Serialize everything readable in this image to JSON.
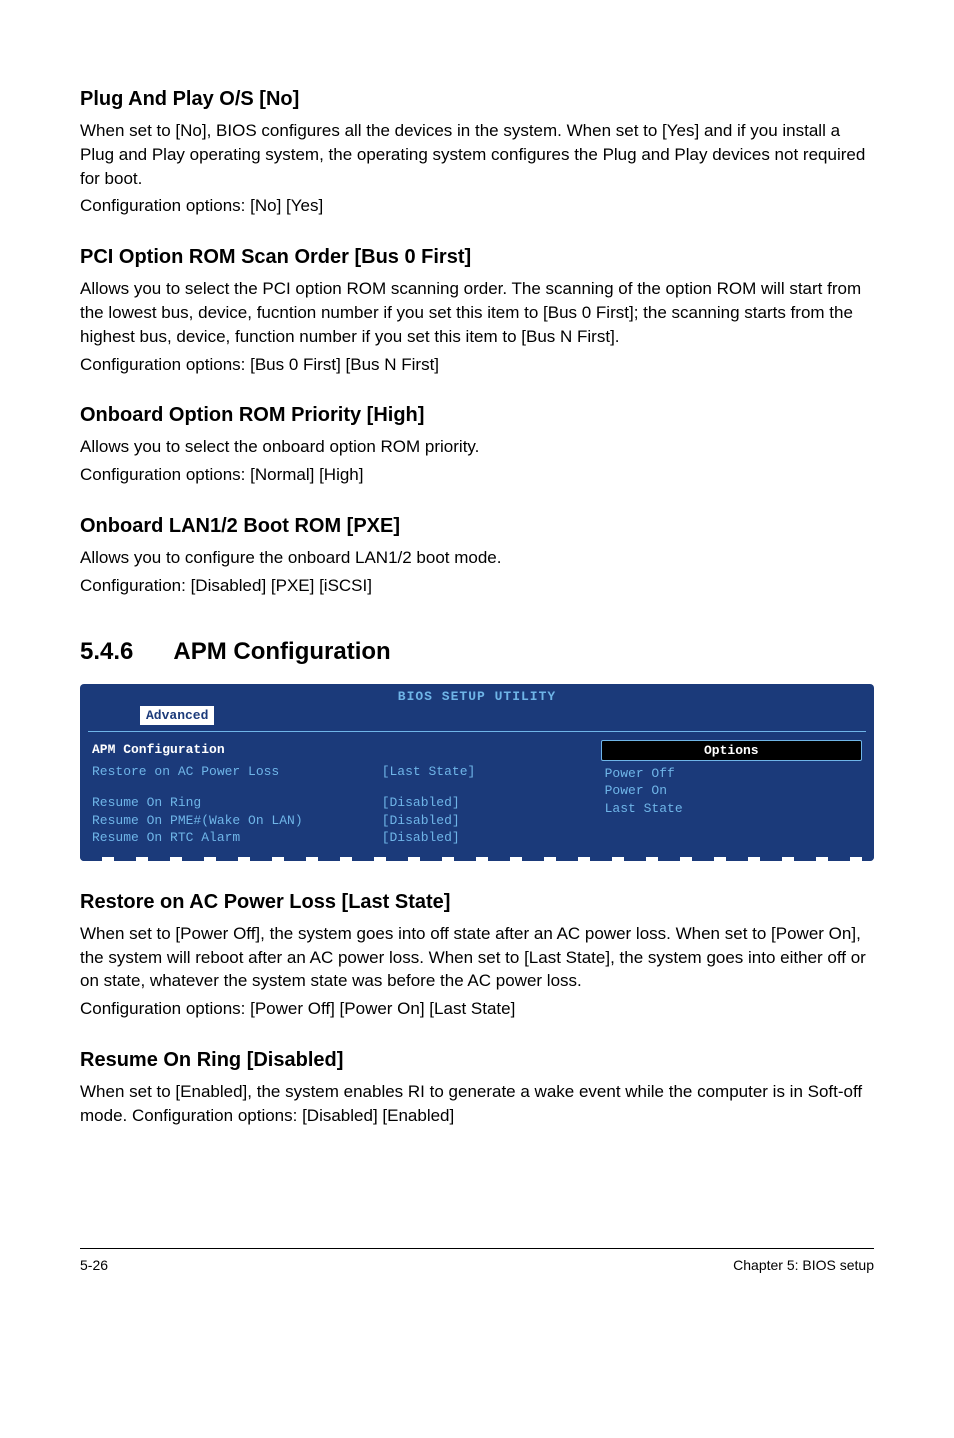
{
  "sections": {
    "s1": {
      "heading": "Plug And Play O/S [No]",
      "body": "When set to [No], BIOS configures all the devices in the system. When set to [Yes] and if you install a Plug and Play operating system, the operating system configures the Plug and Play devices not required for boot.",
      "config": "Configuration options: [No] [Yes]"
    },
    "s2": {
      "heading": "PCI Option ROM Scan Order [Bus 0 First]",
      "body": "Allows you to select the PCI option ROM scanning order. The scanning of the option ROM will start from the lowest bus, device, fucntion number if you set this item to [Bus 0 First]; the scanning starts from the highest bus, device, function number if you set this item to [Bus N First].",
      "config": "Configuration options: [Bus 0 First] [Bus N First]"
    },
    "s3": {
      "heading": "Onboard Option ROM Priority [High]",
      "body": "Allows you to select the onboard option ROM priority.",
      "config": "Configuration options: [Normal] [High]"
    },
    "s4": {
      "heading": "Onboard LAN1/2 Boot ROM [PXE]",
      "body": "Allows you to configure the onboard LAN1/2 boot mode.",
      "config": "Configuration: [Disabled] [PXE] [iSCSI]"
    },
    "s5": {
      "heading": "Restore on AC Power Loss [Last State]",
      "body": "When set to [Power Off], the system goes into off state after an AC power loss. When set to [Power On], the system will reboot after an AC power loss. When set to [Last State], the system goes into either off or on state, whatever the system state was before the AC power loss.",
      "config": "Configuration options: [Power Off] [Power On] [Last State]"
    },
    "s6": {
      "heading": "Resume On Ring [Disabled]",
      "body": "When set to [Enabled], the system enables RI to generate a wake event while the computer is in Soft-off mode. Configuration options: [Disabled] [Enabled]"
    }
  },
  "subsection": {
    "number": "5.4.6",
    "title": "APM Configuration"
  },
  "bios": {
    "header": "BIOS SETUP UTILITY",
    "tab": "Advanced",
    "sub_header": "APM Configuration",
    "rows": {
      "r1": {
        "label": "Restore on AC Power Loss",
        "value": "[Last State]"
      },
      "r2": {
        "label": "Resume On Ring",
        "value": "[Disabled]"
      },
      "r3": {
        "label": "Resume On PME#(Wake On LAN)",
        "value": "[Disabled]"
      },
      "r4": {
        "label": "Resume On RTC Alarm",
        "value": "[Disabled]"
      }
    },
    "options_label": "Options",
    "options": {
      "o1": "Power Off",
      "o2": "Power On",
      "o3": "Last State"
    }
  },
  "footer": {
    "page": "5-26",
    "chapter": "Chapter 5: BIOS setup"
  }
}
